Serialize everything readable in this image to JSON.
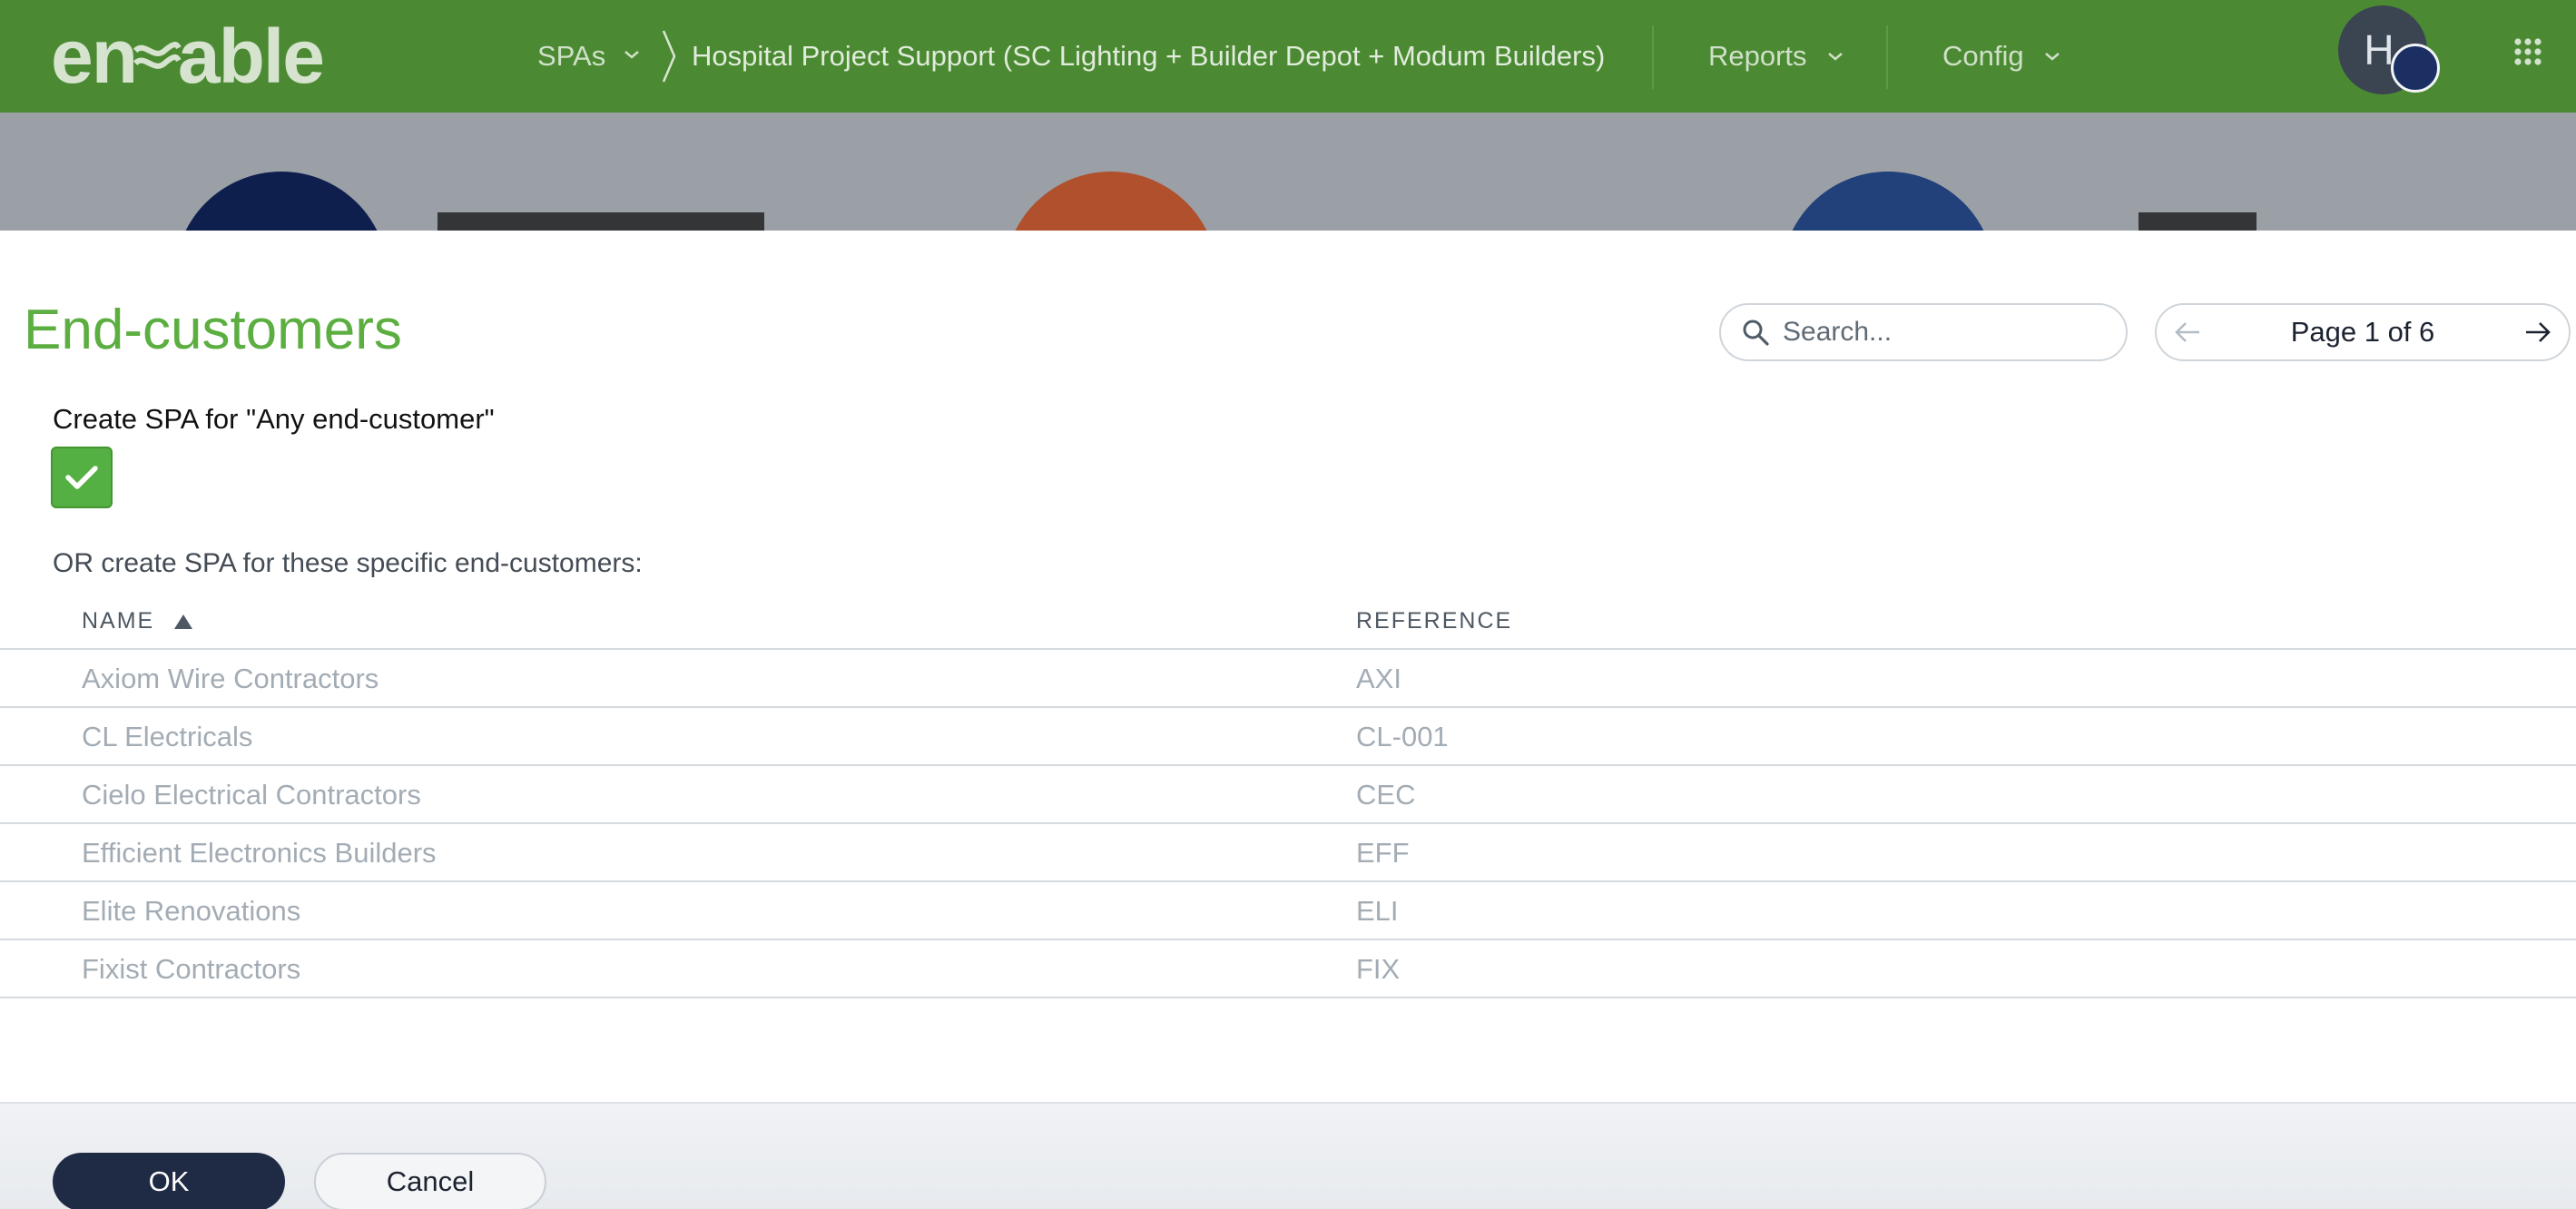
{
  "header": {
    "logo_text_left": "en",
    "logo_text_right": "able",
    "nav": {
      "spas_label": "SPAs",
      "project_label": "Hospital Project Support (SC Lighting + Builder Depot + Modum Builders)",
      "reports_label": "Reports",
      "config_label": "Config"
    },
    "avatar_initial": "H"
  },
  "modal": {
    "title": "End-customers",
    "search": {
      "placeholder": "Search..."
    },
    "pagination": {
      "label": "Page 1 of 6",
      "current_page": 1,
      "total_pages": 6
    },
    "any_customer_label": "Create SPA for \"Any end-customer\"",
    "any_customer_checked": true,
    "specific_label": "OR create SPA for these specific end-customers:",
    "table": {
      "columns": [
        "NAME",
        "REFERENCE"
      ],
      "sort_column": "NAME",
      "sort_direction": "ascending",
      "rows": [
        {
          "name": "Axiom Wire Contractors",
          "reference": "AXI"
        },
        {
          "name": "CL Electricals",
          "reference": "CL-001"
        },
        {
          "name": "Cielo Electrical Contractors",
          "reference": "CEC"
        },
        {
          "name": "Efficient Electronics Builders",
          "reference": "EFF"
        },
        {
          "name": "Elite Renovations",
          "reference": "ELI"
        },
        {
          "name": "Fixist Contractors",
          "reference": "FIX"
        }
      ]
    },
    "footer": {
      "ok_label": "OK",
      "cancel_label": "Cancel"
    }
  },
  "colors": {
    "topbar": "#4b8a32",
    "title_green": "#5cae41",
    "checkbox_green": "#55b043",
    "ok_button": "#1f2a44"
  }
}
